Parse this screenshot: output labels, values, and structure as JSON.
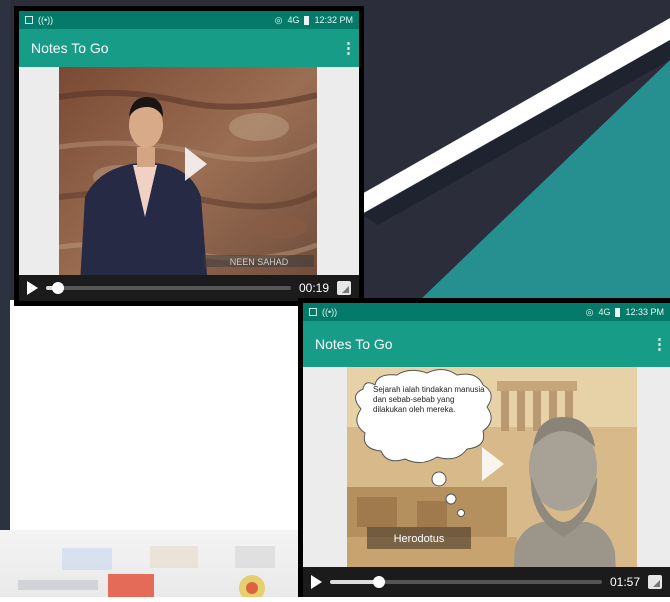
{
  "colors": {
    "status_bar": "#047b6a",
    "app_bar": "#169c87",
    "backdrop_dark": "#2b2e3a",
    "backdrop_teal": "#25908f"
  },
  "screens": [
    {
      "status": {
        "network": "4G",
        "time": "12:32 PM"
      },
      "app_title": "Notes To Go",
      "menu_icon": "more-vert-icon",
      "video": {
        "name_caption": "NEEN SAHAD",
        "progress": 0.05,
        "time": "00:19"
      }
    },
    {
      "status": {
        "network": "4G",
        "time": "12:33 PM"
      },
      "app_title": "Notes To Go",
      "menu_icon": "more-vert-icon",
      "video": {
        "speech_bubble": "Sejarah ialah tindakan manusia dan sebab-sebab yang dilakukan oleh mereka.",
        "caption": "Herodotus",
        "progress": 0.18,
        "time": "01:57"
      }
    }
  ]
}
